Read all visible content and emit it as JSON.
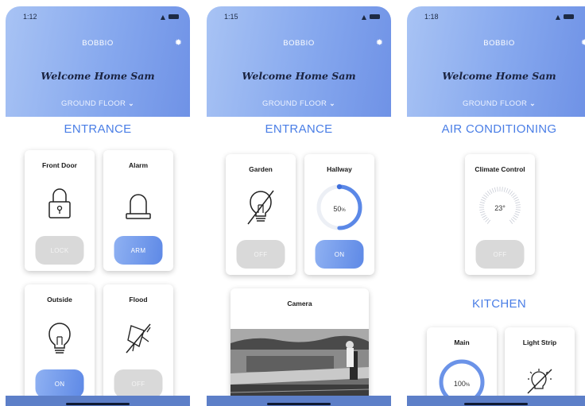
{
  "app": {
    "name": "BOBBIO",
    "welcome": "Welcome Home Sam",
    "floor": "GROUND FLOOR"
  },
  "screens": [
    {
      "time": "1:12",
      "section": "ENTRANCE",
      "cards": [
        {
          "title": "Front Door",
          "icon": "padlock-icon",
          "button": "LOCK",
          "state": "off"
        },
        {
          "title": "Alarm",
          "icon": "alarm-bell-icon",
          "button": "ARM",
          "state": "on"
        },
        {
          "title": "Outside",
          "icon": "light-bulb-icon",
          "button": "ON",
          "state": "on"
        },
        {
          "title": "Flood",
          "icon": "floodlight-off-icon",
          "button": "OFF",
          "state": "off"
        }
      ]
    },
    {
      "time": "1:15",
      "section": "ENTRANCE",
      "cards": [
        {
          "title": "Garden",
          "icon": "light-bulb-off-icon",
          "button": "OFF",
          "state": "off"
        },
        {
          "title": "Hallway",
          "icon": "dimmer-ring-icon",
          "dimmer": "50",
          "unit": "%",
          "level": 0.5,
          "button": "ON",
          "state": "on"
        },
        {
          "title": "Camera",
          "icon": "camera-feed-icon"
        }
      ]
    },
    {
      "time": "1:18",
      "section": "AIR CONDITIONING",
      "section2": "KITCHEN",
      "cards": [
        {
          "title": "Climate Control",
          "icon": "thermostat-dial-icon",
          "temperature": "23°",
          "button": "OFF",
          "state": "off"
        },
        {
          "title": "Main",
          "icon": "dimmer-ring-icon",
          "dimmer": "100",
          "unit": "%",
          "level": 1.0
        },
        {
          "title": "Light Strip",
          "icon": "light-strip-off-icon"
        }
      ]
    }
  ],
  "colors": {
    "accent": "#4a7ee6",
    "header_start": "#a8c3f4",
    "header_end": "#6f92e6",
    "button_on": "#6b93e8",
    "button_off": "#d9d9d9"
  }
}
